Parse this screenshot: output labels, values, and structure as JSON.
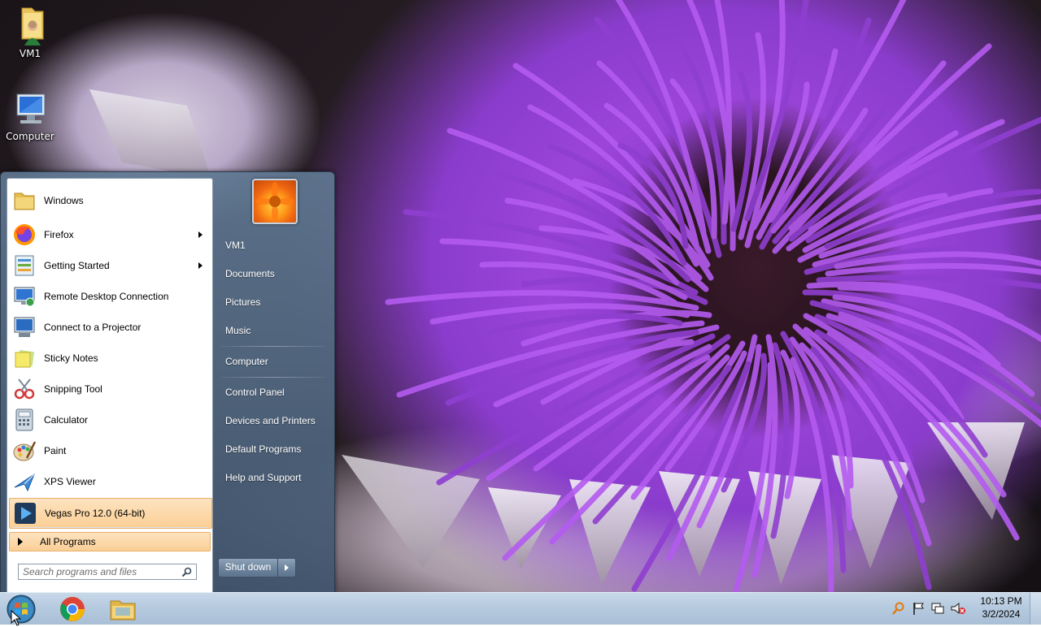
{
  "desktop": {
    "icons": [
      {
        "label": "VM1",
        "icon": "user-folder-icon"
      },
      {
        "label": "Computer",
        "icon": "computer-icon"
      }
    ]
  },
  "start_menu": {
    "programs": [
      {
        "label": "Windows",
        "icon": "folder-icon",
        "submenu": false
      },
      {
        "label": "Firefox",
        "icon": "firefox-icon",
        "submenu": true
      },
      {
        "label": "Getting Started",
        "icon": "getting-started-icon",
        "submenu": true
      },
      {
        "label": "Remote Desktop Connection",
        "icon": "remote-desktop-icon",
        "submenu": false
      },
      {
        "label": "Connect to a Projector",
        "icon": "projector-icon",
        "submenu": false
      },
      {
        "label": "Sticky Notes",
        "icon": "sticky-notes-icon",
        "submenu": false
      },
      {
        "label": "Snipping Tool",
        "icon": "scissors-icon",
        "submenu": false
      },
      {
        "label": "Calculator",
        "icon": "calculator-icon",
        "submenu": false
      },
      {
        "label": "Paint",
        "icon": "paint-palette-icon",
        "submenu": false
      },
      {
        "label": "XPS Viewer",
        "icon": "xps-viewer-icon",
        "submenu": false
      },
      {
        "label": "Vegas Pro 12.0 (64-bit)",
        "icon": "play-icon",
        "submenu": false,
        "highlighted": true
      }
    ],
    "all_programs_label": "All Programs",
    "search_placeholder": "Search programs and files",
    "right_items": [
      "VM1",
      "Documents",
      "Pictures",
      "Music",
      "Computer",
      "Control Panel",
      "Devices and Printers",
      "Default Programs",
      "Help and Support"
    ],
    "shutdown_label": "Shut down"
  },
  "taskbar": {
    "pinned": [
      {
        "name": "Google Chrome",
        "icon": "chrome-icon"
      },
      {
        "name": "Windows Explorer",
        "icon": "explorer-folder-icon"
      }
    ],
    "tray_icons": [
      "search-icon",
      "flag-icon",
      "network-icon",
      "volume-muted-icon"
    ],
    "clock_time": "10:13 PM",
    "clock_date": "3/2/2024"
  },
  "colors": {
    "highlight": "#fbcf95",
    "taskbar": "#b6cadf",
    "wallpaper_accent": "#9b45d8"
  }
}
